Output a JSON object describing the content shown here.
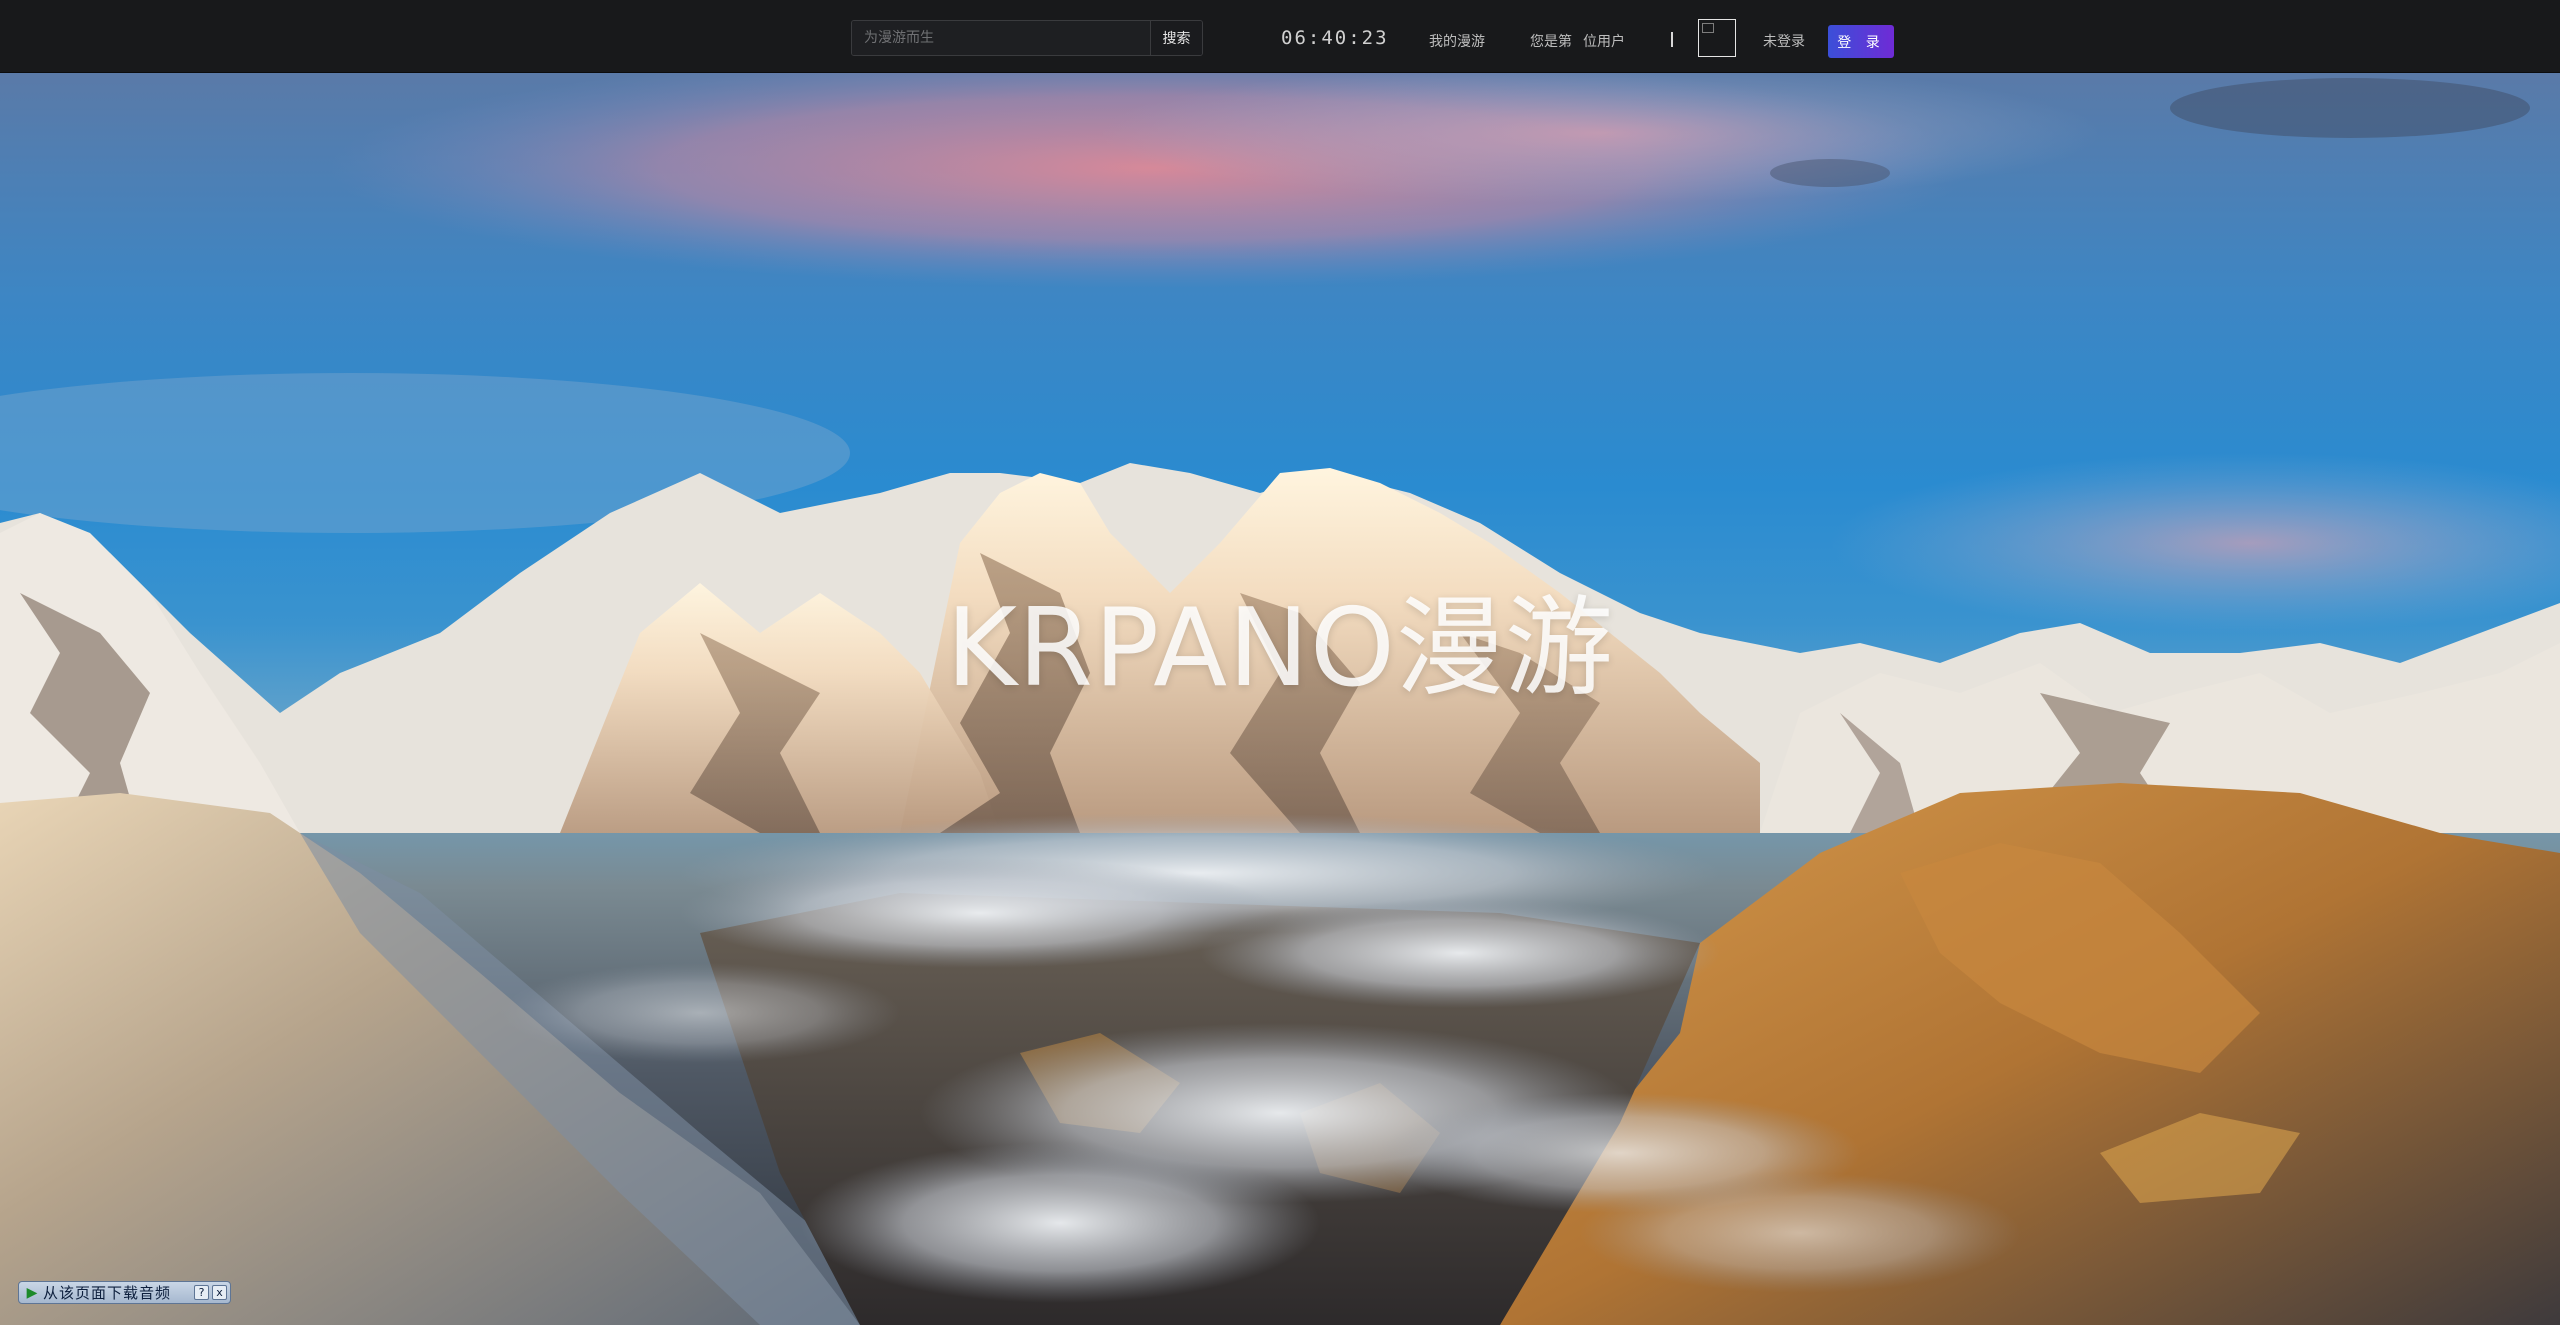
{
  "header": {
    "search": {
      "placeholder": "为漫游而生",
      "button_label": "搜索"
    },
    "clock": "06:40:23",
    "my_tour_label": "我的漫游",
    "visitor": {
      "prefix": "您是第",
      "count": "",
      "suffix": "位用户"
    },
    "divider_text": "|",
    "avatar_icon": "broken-image-icon",
    "login_status": "未登录",
    "login_button_label": "登 录",
    "login_button_gradient": [
      "#3b4fd8",
      "#6f2bd6"
    ]
  },
  "hero": {
    "title": "KRPANO漫游",
    "background_description_icon": "mountain-panorama-photo"
  },
  "audio_widget": {
    "play_icon": "play-icon",
    "label": "从该页面下载音频",
    "help_label": "?",
    "close_label": "x"
  }
}
